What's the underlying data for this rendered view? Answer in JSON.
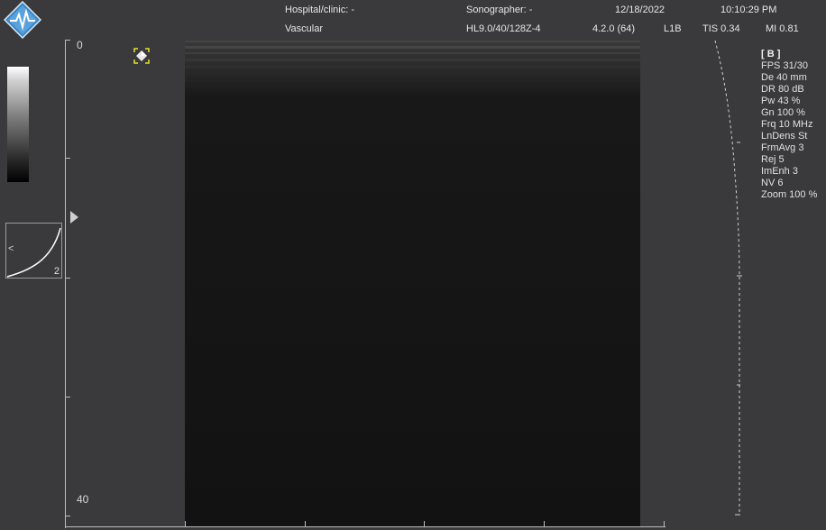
{
  "header": {
    "hospital": "Hospital/clinic: -",
    "sonographer": "Sonographer: -",
    "date": "12/18/2022",
    "time": "10:10:29 PM",
    "exam": "Vascular",
    "probe": "HL9.0/40/128Z-4",
    "version": "4.2.0 (64)",
    "line_id": "L1B",
    "tis": "TIS 0.34",
    "mi": "MI 0.81"
  },
  "depth": {
    "top_label": "0",
    "bottom_label": "40"
  },
  "curve_box": {
    "left_glyph": "<",
    "number": "2"
  },
  "params": {
    "mode": "[ B ]",
    "lines": [
      "FPS 31/30",
      "De 40 mm",
      "DR 80 dB",
      "Pw 43 %",
      "Gn 100 %",
      "Frq 10 MHz",
      "LnDens St",
      "FrmAvg 3",
      "Rej 5",
      "ImEnh 3",
      "NV 6",
      "Zoom 100 %"
    ]
  },
  "icons": {
    "logo": "heartbeat-logo-icon",
    "probe_marker": "probe-orientation-icon",
    "focus": "focus-marker-icon"
  },
  "colors": {
    "background": "#3a3a3c",
    "image": "#141414",
    "logo_blue": "#3d86c6",
    "marker_yellow": "#e5e52a"
  }
}
